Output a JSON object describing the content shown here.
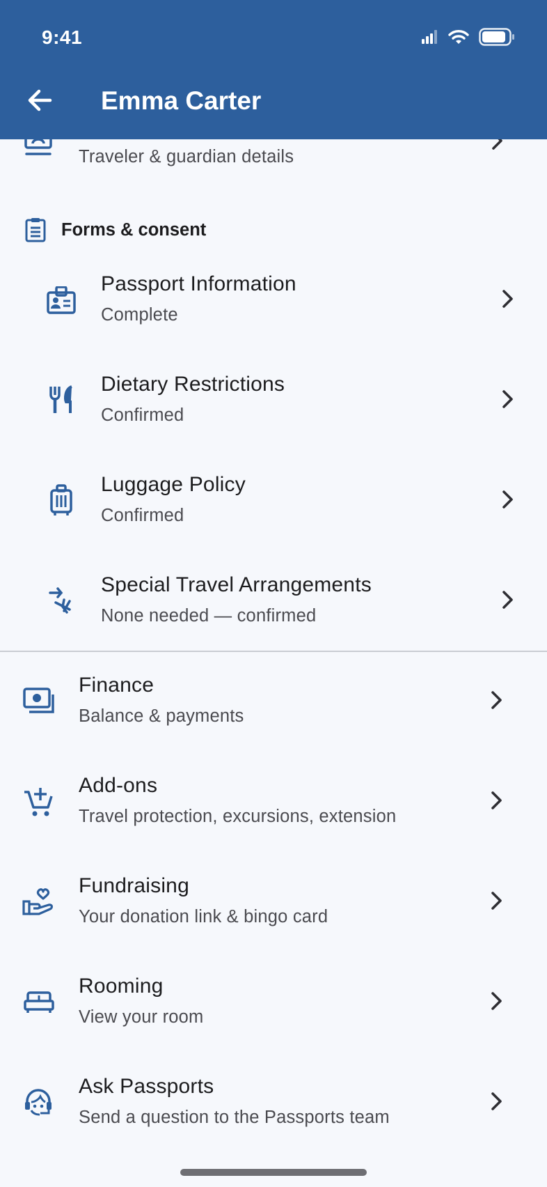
{
  "status_bar": {
    "time": "9:41"
  },
  "header": {
    "title": "Emma Carter"
  },
  "top_partial_item": {
    "subtitle": "Traveler & guardian details"
  },
  "forms_section": {
    "heading": "Forms & consent",
    "items": [
      {
        "label": "Passport Information",
        "subtitle": "Complete",
        "icon": "passport-id-icon"
      },
      {
        "label": "Dietary Restrictions",
        "subtitle": "Confirmed",
        "icon": "fork-knife-icon"
      },
      {
        "label": "Luggage Policy",
        "subtitle": "Confirmed",
        "icon": "luggage-icon"
      },
      {
        "label": "Special Travel Arrangements",
        "subtitle": "None needed — confirmed",
        "icon": "flights-icon"
      }
    ]
  },
  "menu_items": [
    {
      "label": "Finance",
      "subtitle": "Balance & payments",
      "icon": "payments-icon"
    },
    {
      "label": "Add-ons",
      "subtitle": "Travel protection, excursions, extension",
      "icon": "add-cart-icon"
    },
    {
      "label": "Fundraising",
      "subtitle": "Your donation link & bingo card",
      "icon": "donation-hand-icon"
    },
    {
      "label": "Rooming",
      "subtitle": "View your room",
      "icon": "bed-icon"
    },
    {
      "label": "Ask Passports",
      "subtitle": "Send a question to the Passports team",
      "icon": "support-agent-icon"
    }
  ],
  "colors": {
    "header_bg": "#2D5F9D",
    "icon": "#2D5F9D",
    "background": "#F6F8FC"
  }
}
